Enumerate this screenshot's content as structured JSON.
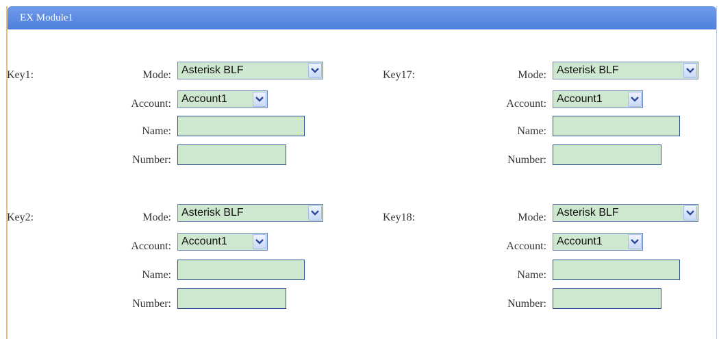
{
  "panel": {
    "title": "EX Module1"
  },
  "labels": {
    "mode": "Mode:",
    "account": "Account:",
    "name": "Name:",
    "number": "Number:"
  },
  "keys": [
    {
      "label": "Key1:",
      "mode": "Asterisk BLF",
      "account": "Account1",
      "name": "",
      "number": ""
    },
    {
      "label": "Key17:",
      "mode": "Asterisk BLF",
      "account": "Account1",
      "name": "",
      "number": ""
    },
    {
      "label": "Key2:",
      "mode": "Asterisk BLF",
      "account": "Account1",
      "name": "",
      "number": ""
    },
    {
      "label": "Key18:",
      "mode": "Asterisk BLF",
      "account": "Account1",
      "name": "",
      "number": ""
    }
  ],
  "icons": {
    "dropdown": "chevron-down-icon"
  },
  "colors": {
    "header": "#5a88e2",
    "field_bg": "#cde8cf",
    "field_border": "#2d4f9a"
  }
}
